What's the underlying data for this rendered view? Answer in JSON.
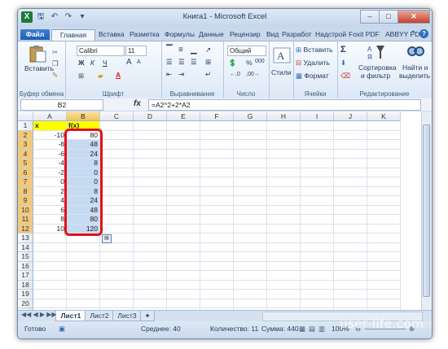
{
  "window": {
    "title": "Книга1 - Microsoft Excel",
    "controls": {
      "minimize": "–",
      "maximize": "□",
      "close": "✕"
    }
  },
  "quick_access": [
    "save-icon",
    "undo-icon",
    "redo-icon",
    "customize-icon"
  ],
  "ribbon_tabs": [
    "Файл",
    "Главная",
    "Вставка",
    "Разметка",
    "Формулы",
    "Данные",
    "Рецензир",
    "Вид",
    "Разработ",
    "Надстрой",
    "Foxit PDF",
    "ABBYY PD"
  ],
  "ribbon": {
    "clipboard": {
      "paste_label": "Вставить",
      "group_label": "Буфер обмена"
    },
    "font": {
      "name": "Calibri",
      "size": "11",
      "bold": "Ж",
      "italic": "К",
      "underline": "Ч",
      "grow": "A",
      "shrink": "A",
      "group_label": "Шрифт"
    },
    "alignment": {
      "group_label": "Выравнивание"
    },
    "number": {
      "format": "Общий",
      "percent": "%",
      "thousands": "000",
      "group_label": "Число"
    },
    "styles": {
      "label": "Стили"
    },
    "cells": {
      "insert": "Вставить",
      "delete": "Удалить",
      "format": "Формат",
      "group_label": "Ячейки"
    },
    "editing": {
      "sum": "Σ",
      "sort_line1": "Сортировка",
      "sort_line2": "и фильтр",
      "find_line1": "Найти и",
      "find_line2": "выделить",
      "group_label": "Редактирование"
    }
  },
  "formula_bar": {
    "name_box": "B2",
    "fx": "fx",
    "formula": "=A2^2+2*A2"
  },
  "grid": {
    "columns": [
      "A",
      "B",
      "C",
      "D",
      "E",
      "F",
      "G",
      "H",
      "I",
      "J",
      "K"
    ],
    "rows": [
      "1",
      "2",
      "3",
      "4",
      "5",
      "6",
      "7",
      "8",
      "9",
      "10",
      "11",
      "12",
      "13",
      "14",
      "15",
      "16",
      "17",
      "18",
      "19",
      "20",
      "21"
    ],
    "header_a": "x",
    "header_b": "f(x)",
    "x_values": [
      "-10",
      "-8",
      "-6",
      "-4",
      "-2",
      "0",
      "2",
      "4",
      "6",
      "8",
      "10"
    ],
    "f_values": [
      "80",
      "48",
      "24",
      "8",
      "0",
      "0",
      "8",
      "24",
      "48",
      "80",
      "120"
    ]
  },
  "sheets": [
    "Лист1",
    "Лист2",
    "Лист3"
  ],
  "status": {
    "ready": "Готово",
    "average": "Среднее: 40",
    "count": "Количество: 11",
    "sum": "Сумма: 440",
    "zoom": "100%"
  },
  "watermark": "user-life.com"
}
